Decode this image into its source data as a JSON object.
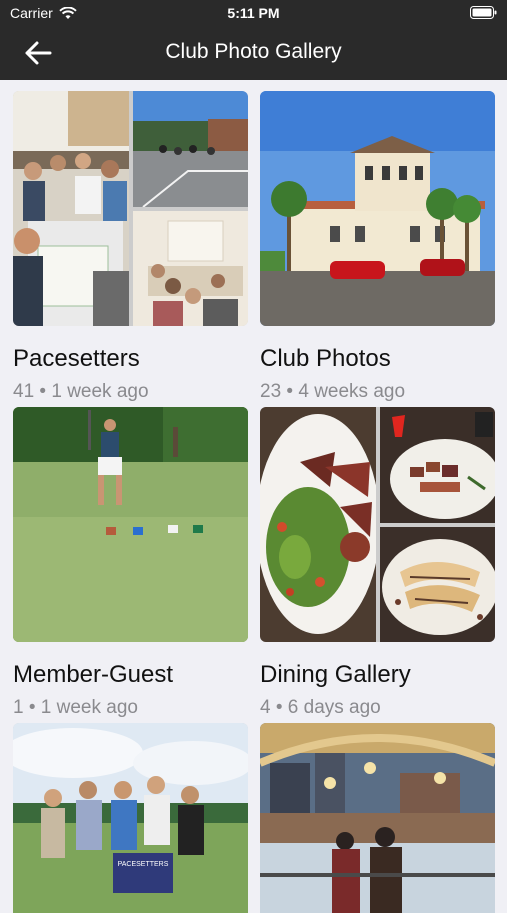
{
  "status_bar": {
    "carrier": "Carrier",
    "time": "5:11 PM"
  },
  "nav": {
    "title": "Club Photo Gallery"
  },
  "albums": [
    {
      "name": "Pacesetters",
      "meta": "41 • 1 week ago"
    },
    {
      "name": "Club Photos",
      "meta": "23 • 4 weeks ago"
    },
    {
      "name": "Member-Guest",
      "meta": "1 • 1 week ago"
    },
    {
      "name": "Dining Gallery",
      "meta": "4 • 6 days ago"
    },
    {
      "name": "",
      "meta": ""
    },
    {
      "name": "",
      "meta": ""
    }
  ],
  "banner_text": "PACESETTERS"
}
